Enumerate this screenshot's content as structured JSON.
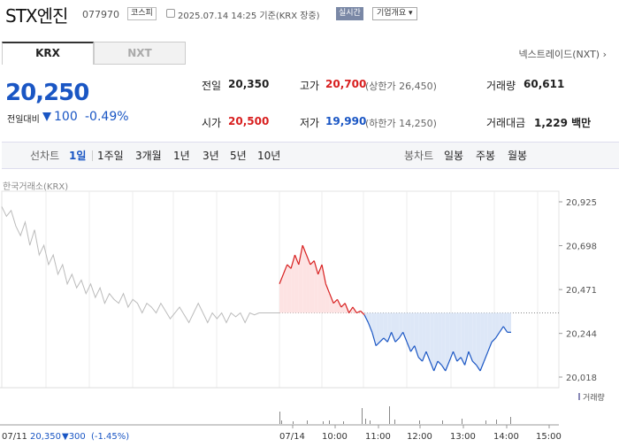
{
  "header": {
    "stock_name": "STX엔진",
    "stock_code": "077970",
    "market": "코스피",
    "datetime_text": "2025.07.14 14:25 기준(KRX 장중)",
    "realtime_badge": "실시간",
    "company_button": "기업개요 ▾"
  },
  "tabs": {
    "krx": "KRX",
    "nxt": "NXT"
  },
  "nextrade_label": "넥스트레이드(NXT) ",
  "price": {
    "current": "20,250",
    "change_label": "전일대비",
    "change_value": "100",
    "change_rate": "-0.49%"
  },
  "stats": {
    "prev_close_label": "전일",
    "prev_close": "20,350",
    "high_label": "고가",
    "high": "20,700",
    "upper_limit": "(상한가 26,450)",
    "volume_label": "거래량",
    "volume": "60,611",
    "open_label": "시가",
    "open": "20,500",
    "low_label": "저가",
    "low": "19,990",
    "lower_limit": "(하한가 14,250)",
    "amount_label": "거래대금",
    "amount": "1,229 백만"
  },
  "period_bar": {
    "line_chart_label": "선차트",
    "line_periods": [
      "1일",
      "1주일",
      "3개월",
      "1년",
      "3년",
      "5년",
      "10년"
    ],
    "active_period": "1일",
    "candle_chart_label": "봉차트",
    "candle_periods": [
      "일봉",
      "주봉",
      "월봉"
    ]
  },
  "exchange_label": "한국거래소(KRX)",
  "colors": {
    "up": "#d81f1f",
    "down": "#1a56c4",
    "up_fill": "#fde3e3",
    "down_fill": "#dde7f7"
  },
  "chart_data": {
    "type": "line",
    "title": "",
    "ylim": [
      20018,
      20925
    ],
    "y_ticks": [
      "20,925",
      "20,698",
      "20,471",
      "20,244",
      "20,018"
    ],
    "y_tick_values": [
      20925,
      20698,
      20471,
      20244,
      20018
    ],
    "baseline": 20350,
    "prev_day": {
      "date": "07/11",
      "values": [
        20900,
        20850,
        20880,
        20800,
        20750,
        20820,
        20700,
        20780,
        20650,
        20700,
        20600,
        20650,
        20550,
        20600,
        20500,
        20550,
        20480,
        20520,
        20450,
        20500,
        20430,
        20480,
        20400,
        20450,
        20420,
        20400,
        20450,
        20380,
        20420,
        20400,
        20350,
        20400,
        20380,
        20350,
        20400,
        20360,
        20320,
        20350,
        20380,
        20340,
        20300,
        20350,
        20400,
        20350,
        20300,
        20350,
        20320,
        20350,
        20300,
        20350,
        20330,
        20350,
        20300,
        20350,
        20340,
        20350
      ]
    },
    "today": {
      "date": "07/14",
      "x_ticks": [
        "07/14",
        "10:00",
        "11:00",
        "12:00",
        "13:00",
        "14:00",
        "15:00"
      ],
      "values": [
        20500,
        20550,
        20600,
        20580,
        20650,
        20600,
        20700,
        20650,
        20600,
        20620,
        20550,
        20600,
        20500,
        20450,
        20400,
        20420,
        20380,
        20400,
        20350,
        20380,
        20350,
        20360,
        20340,
        20300,
        20250,
        20180,
        20200,
        20220,
        20200,
        20250,
        20200,
        20220,
        20250,
        20200,
        20150,
        20180,
        20120,
        20100,
        20150,
        20100,
        20050,
        20100,
        20080,
        20050,
        20100,
        20150,
        20100,
        20120,
        20080,
        20150,
        20100,
        20080,
        20050,
        20100,
        20150,
        20200,
        20220,
        20250,
        20280,
        20250,
        20250
      ]
    },
    "volume_label": "거래량",
    "footer": {
      "date": "07/11",
      "close": "20,350",
      "change": "▼300",
      "rate": "(-1.45%)"
    }
  }
}
